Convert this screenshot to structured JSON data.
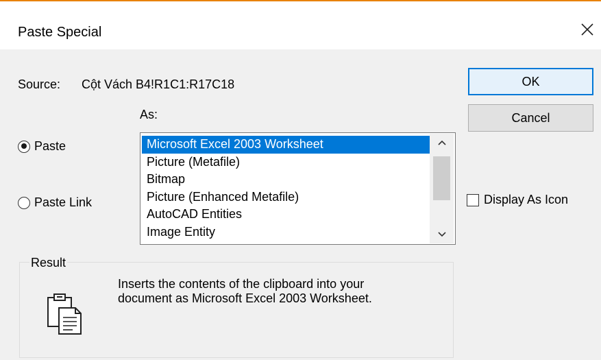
{
  "dialog": {
    "title": "Paste Special",
    "close_icon": "close-icon"
  },
  "source": {
    "label": "Source:",
    "value": "Cột Vách B4!R1C1:R17C18"
  },
  "as_label": "As:",
  "buttons": {
    "ok": "OK",
    "cancel": "Cancel"
  },
  "options": {
    "paste": {
      "label": "Paste",
      "checked": true
    },
    "paste_link": {
      "label": "Paste Link",
      "checked": false
    }
  },
  "as_list": {
    "items": [
      "Microsoft Excel 2003 Worksheet",
      "Picture (Metafile)",
      "Bitmap",
      "Picture (Enhanced Metafile)",
      "AutoCAD Entities",
      "Image Entity"
    ],
    "selected_index": 0
  },
  "display_as_icon": {
    "label": "Display As Icon",
    "checked": false
  },
  "result": {
    "legend": "Result",
    "line1": "Inserts the contents of the clipboard into your",
    "line2": "document as Microsoft Excel 2003 Worksheet.",
    "icon": "clipboard-paste-icon"
  },
  "colors": {
    "accent": "#0078d7",
    "title_border": "#e8820c",
    "dialog_bg": "#f0f0f0"
  }
}
